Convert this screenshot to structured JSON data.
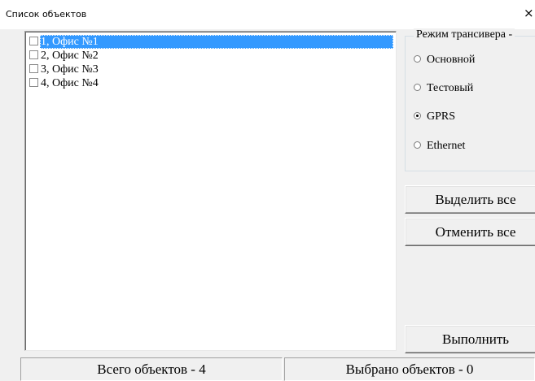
{
  "window": {
    "title": "Список объектов",
    "close_glyph": "×"
  },
  "list": {
    "items": [
      {
        "label": "1, Офис №1",
        "checked": false,
        "selected": true
      },
      {
        "label": "2, Офис №2",
        "checked": false,
        "selected": false
      },
      {
        "label": "3, Офис №3",
        "checked": false,
        "selected": false
      },
      {
        "label": "4, Офис №4",
        "checked": false,
        "selected": false
      }
    ]
  },
  "transceiver": {
    "group_label": "Режим трансивера -",
    "options": [
      {
        "label": "Основной",
        "selected": false
      },
      {
        "label": "Тестовый",
        "selected": false
      },
      {
        "label": "GPRS",
        "selected": true
      },
      {
        "label": "Ethernet",
        "selected": false
      }
    ]
  },
  "buttons": {
    "select_all": "Выделить все",
    "cancel_all": "Отменить все",
    "execute": "Выполнить"
  },
  "status": {
    "total": "Всего объектов - 4",
    "selected": "Выбрано объектов - 0"
  },
  "colors": {
    "selection": "#3399ff",
    "window_bg": "#f0f0f0"
  }
}
